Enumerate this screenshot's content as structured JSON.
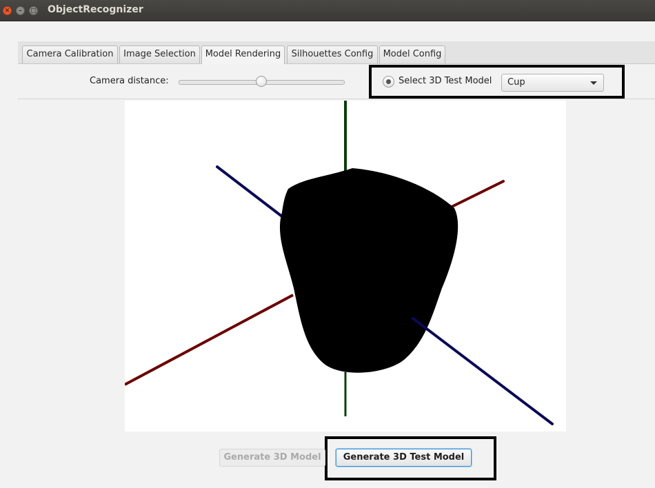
{
  "window": {
    "title": "ObjectRecognizer"
  },
  "tabs": [
    {
      "label": "Camera Calibration",
      "active": false
    },
    {
      "label": "Image Selection",
      "active": false
    },
    {
      "label": "Model Rendering",
      "active": true
    },
    {
      "label": "Silhouettes Config",
      "active": false
    },
    {
      "label": "Model Config",
      "active": false
    }
  ],
  "config": {
    "camera_distance_label": "Camera distance:",
    "camera_distance_value": 0.5,
    "test_model_radio_label": "Select 3D Test Model",
    "test_model_radio_selected": true,
    "test_model_selected": "Cup"
  },
  "viewport": {
    "axis_colors": {
      "x": "#6b0000",
      "y": "#0b3d0b",
      "z": "#0a0a55"
    },
    "model_color": "#000000",
    "background": "#ffffff"
  },
  "actions": {
    "generate_model_label": "Generate 3D Model",
    "generate_model_enabled": false,
    "generate_test_model_label": "Generate 3D Test Model"
  },
  "highlight_color": "#000000"
}
